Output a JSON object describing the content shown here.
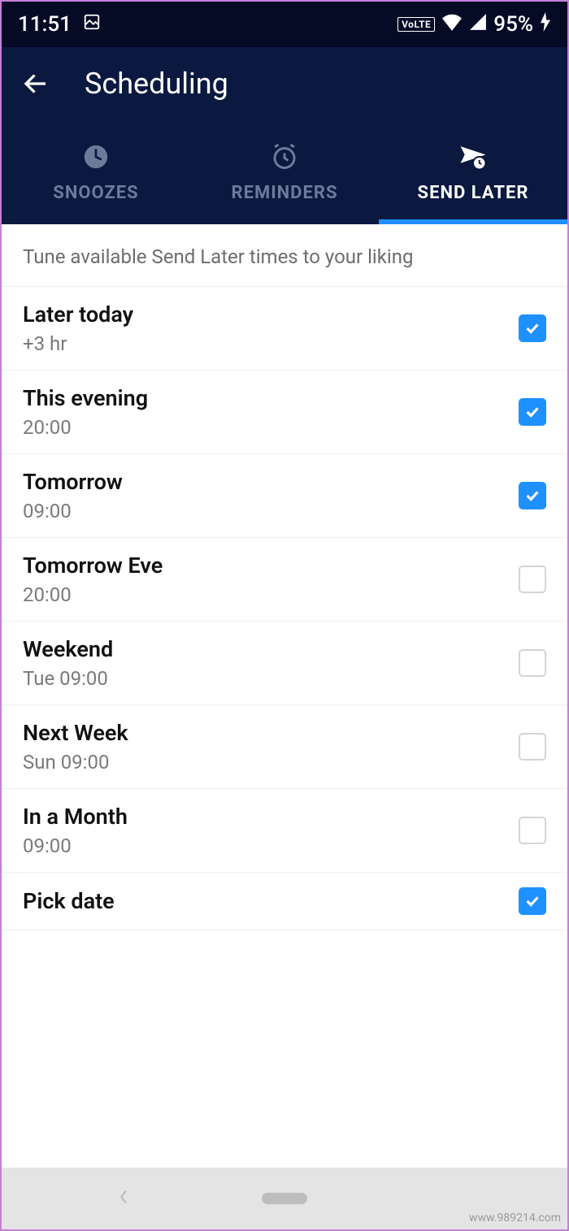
{
  "status": {
    "time": "11:51",
    "volte": "VoLTE",
    "battery": "95%"
  },
  "header": {
    "title": "Scheduling"
  },
  "tabs": {
    "items": [
      {
        "label": "SNOOZES",
        "active": false
      },
      {
        "label": "REMINDERS",
        "active": false
      },
      {
        "label": "SEND LATER",
        "active": true
      }
    ]
  },
  "content": {
    "description": "Tune available Send Later times to your liking",
    "options": [
      {
        "title": "Later today",
        "sub": "+3 hr",
        "checked": true
      },
      {
        "title": "This evening",
        "sub": "20:00",
        "checked": true
      },
      {
        "title": "Tomorrow",
        "sub": "09:00",
        "checked": true
      },
      {
        "title": "Tomorrow Eve",
        "sub": "20:00",
        "checked": false
      },
      {
        "title": "Weekend",
        "sub": "Tue 09:00",
        "checked": false
      },
      {
        "title": "Next Week",
        "sub": "Sun 09:00",
        "checked": false
      },
      {
        "title": "In a Month",
        "sub": "09:00",
        "checked": false
      },
      {
        "title": "Pick date",
        "sub": "",
        "checked": true
      }
    ]
  },
  "watermark": "www.989214.com"
}
